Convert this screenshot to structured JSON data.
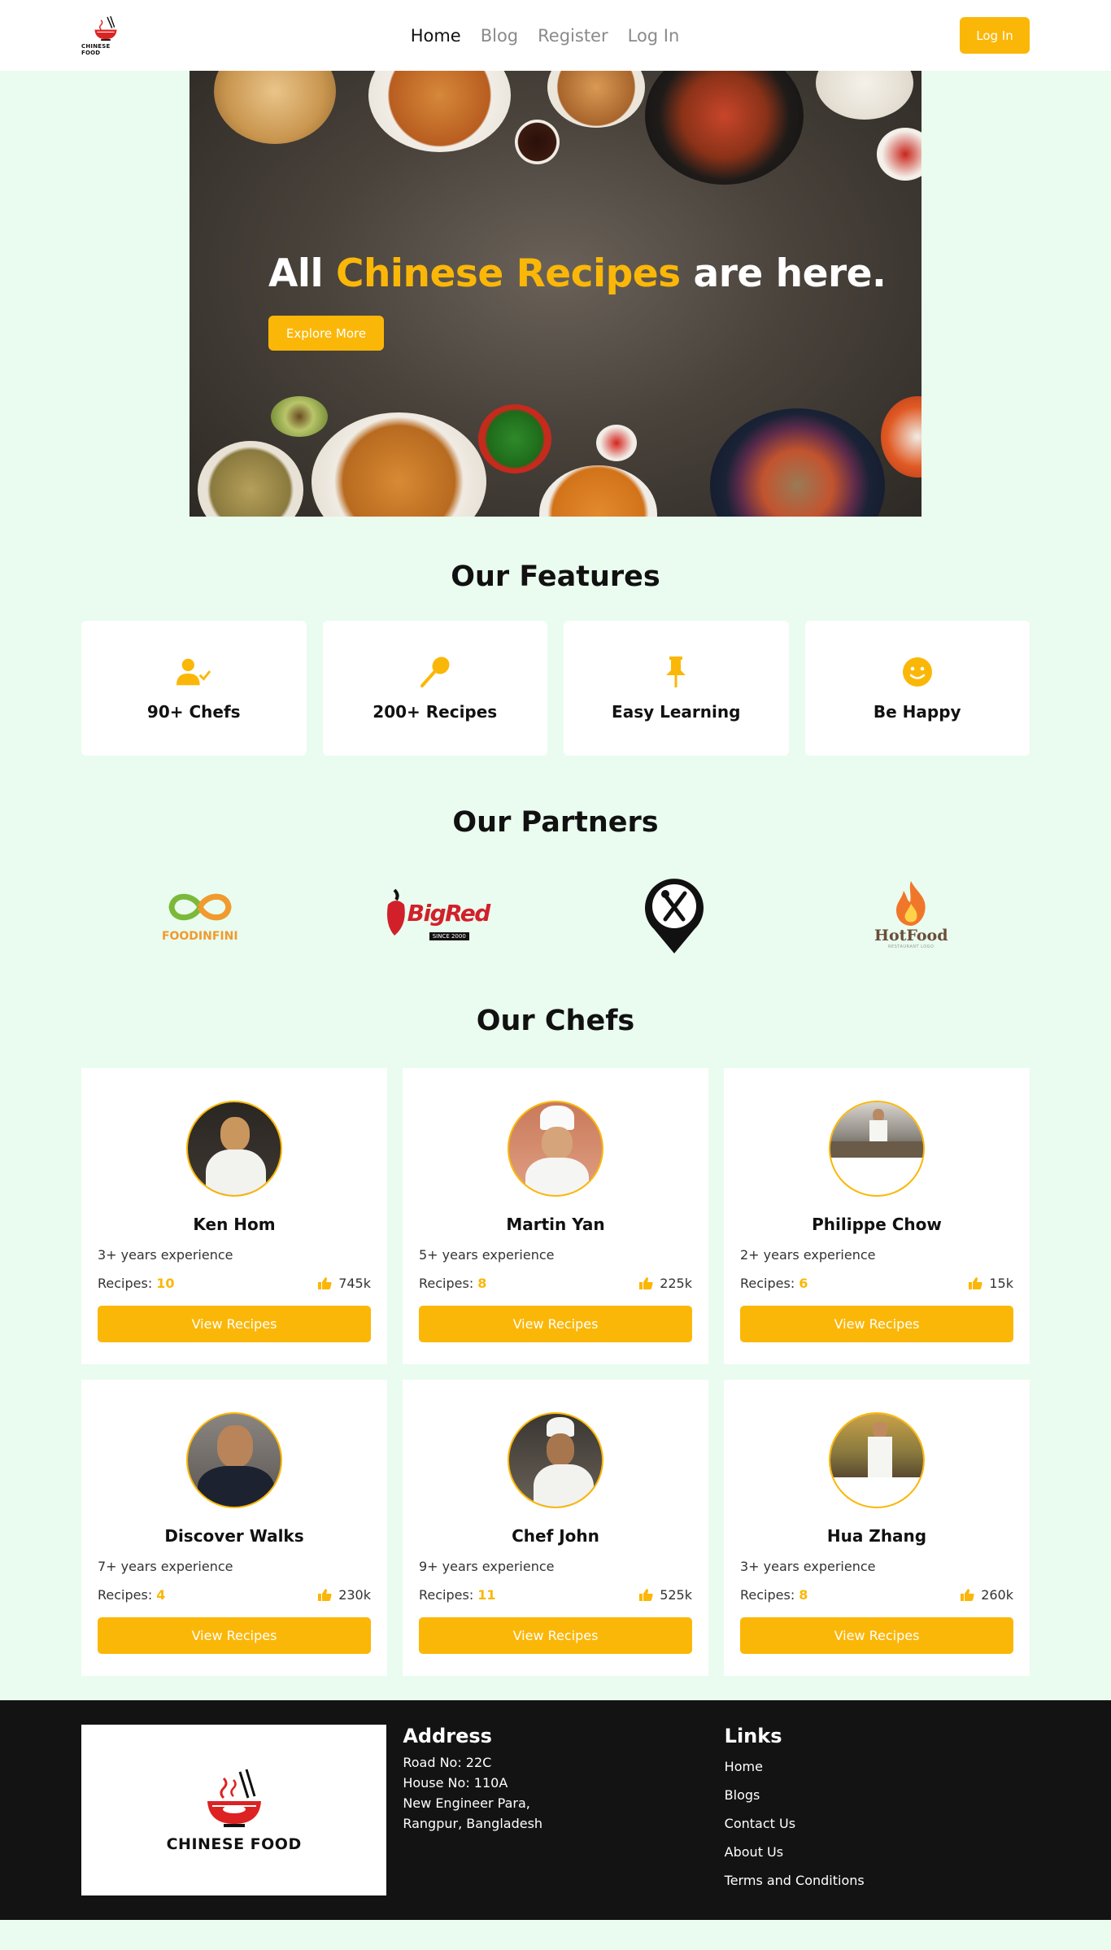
{
  "brand": {
    "name": "CHINESE FOOD"
  },
  "nav": {
    "links": [
      "Home",
      "Blog",
      "Register",
      "Log In"
    ],
    "login_button": "Log In"
  },
  "hero": {
    "title_start": "All ",
    "title_accent": "Chinese Recipes",
    "title_end": " are here.",
    "cta": "Explore More"
  },
  "features": {
    "title": "Our Features",
    "items": [
      {
        "label": "90+ Chefs",
        "icon": "chef-user-icon"
      },
      {
        "label": "200+ Recipes",
        "icon": "spoon-icon"
      },
      {
        "label": "Easy Learning",
        "icon": "pin-icon"
      },
      {
        "label": "Be Happy",
        "icon": "smile-icon"
      }
    ]
  },
  "partners": {
    "title": "Our Partners",
    "items": [
      {
        "name": "FOODINFINI"
      },
      {
        "name": "BigRed",
        "tag": "SINCE 2000"
      },
      {
        "name": "map-fork-knife-logo"
      },
      {
        "name": "HotFood",
        "tag": "RESTAURANT LOGO"
      }
    ]
  },
  "chefs": {
    "title": "Our Chefs",
    "recipes_label": "Recipes: ",
    "button_label": "View Recipes",
    "items": [
      {
        "name": "Ken Hom",
        "experience": "3+ years experience",
        "recipes": "10",
        "likes": "745k"
      },
      {
        "name": "Martin Yan",
        "experience": "5+ years experience",
        "recipes": "8",
        "likes": "225k"
      },
      {
        "name": "Philippe Chow",
        "experience": "2+ years experience",
        "recipes": "6",
        "likes": "15k"
      },
      {
        "name": "Discover Walks",
        "experience": "7+ years experience",
        "recipes": "4",
        "likes": "230k"
      },
      {
        "name": "Chef John",
        "experience": "9+ years experience",
        "recipes": "11",
        "likes": "525k"
      },
      {
        "name": "Hua Zhang",
        "experience": "3+ years experience",
        "recipes": "8",
        "likes": "260k"
      }
    ]
  },
  "footer": {
    "logo_text": "CHINESE FOOD",
    "address_title": "Address",
    "address_lines": [
      "Road No: 22C",
      "House No: 110A",
      "New Engineer Para,",
      "Rangpur, Bangladesh"
    ],
    "links_title": "Links",
    "links": [
      "Home",
      "Blogs",
      "Contact Us",
      "About Us",
      "Terms and Conditions"
    ]
  },
  "colors": {
    "accent": "#fbb708",
    "background": "#e9fcef",
    "footer": "#131313"
  }
}
